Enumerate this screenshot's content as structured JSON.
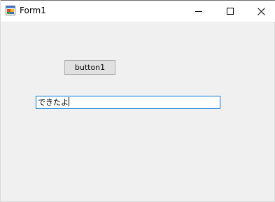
{
  "window": {
    "title": "Form1",
    "app_icon": "winforms-app-icon",
    "controls": {
      "minimize_icon": "minimize-icon",
      "maximize_icon": "maximize-icon",
      "close_icon": "close-icon"
    }
  },
  "form": {
    "button1_label": "button1",
    "textbox1_value": "できたよ"
  },
  "colors": {
    "client_background": "#f0f0f0",
    "button_face": "#e1e1e1",
    "textbox_focus_border": "#0078d7"
  }
}
